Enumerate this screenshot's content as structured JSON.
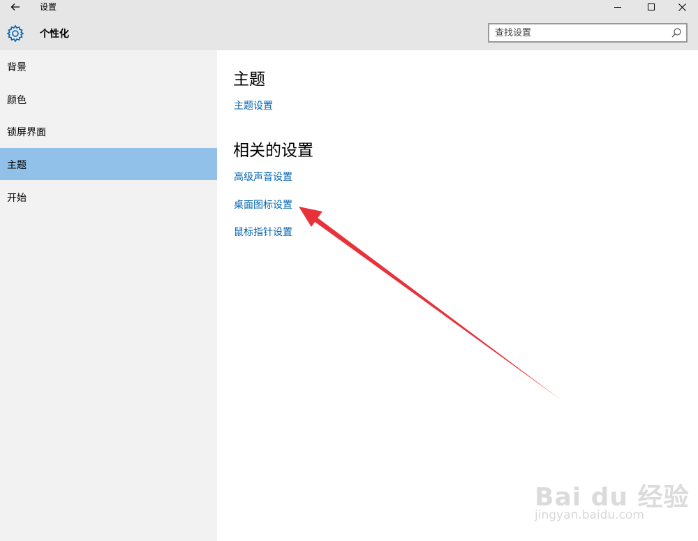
{
  "window": {
    "title": "设置",
    "section": "个性化",
    "controls": [
      "minimize-icon",
      "maximize-icon",
      "close-icon"
    ]
  },
  "search": {
    "placeholder": "查找设置",
    "value": ""
  },
  "sidebar": {
    "items": [
      {
        "label": "背景",
        "selected": false
      },
      {
        "label": "颜色",
        "selected": false
      },
      {
        "label": "锁屏界面",
        "selected": false
      },
      {
        "label": "主题",
        "selected": true
      },
      {
        "label": "开始",
        "selected": false
      }
    ]
  },
  "main": {
    "theme_heading": "主题",
    "theme_link": "主题设置",
    "related_heading": "相关的设置",
    "related_links": [
      "高级声音设置",
      "桌面图标设置",
      "鼠标指针设置"
    ]
  },
  "annotation": {
    "type": "arrow",
    "color": "#e8323a",
    "points_to": "桌面图标设置"
  },
  "watermark": {
    "logo": "Bai du 经验",
    "url": "jingyan.baidu.com"
  },
  "colors": {
    "accent": "#0063b1",
    "selected_bg": "#91c0e9",
    "sidebar_bg": "#f2f2f2",
    "titlebar_bg": "#e6e6e6"
  }
}
